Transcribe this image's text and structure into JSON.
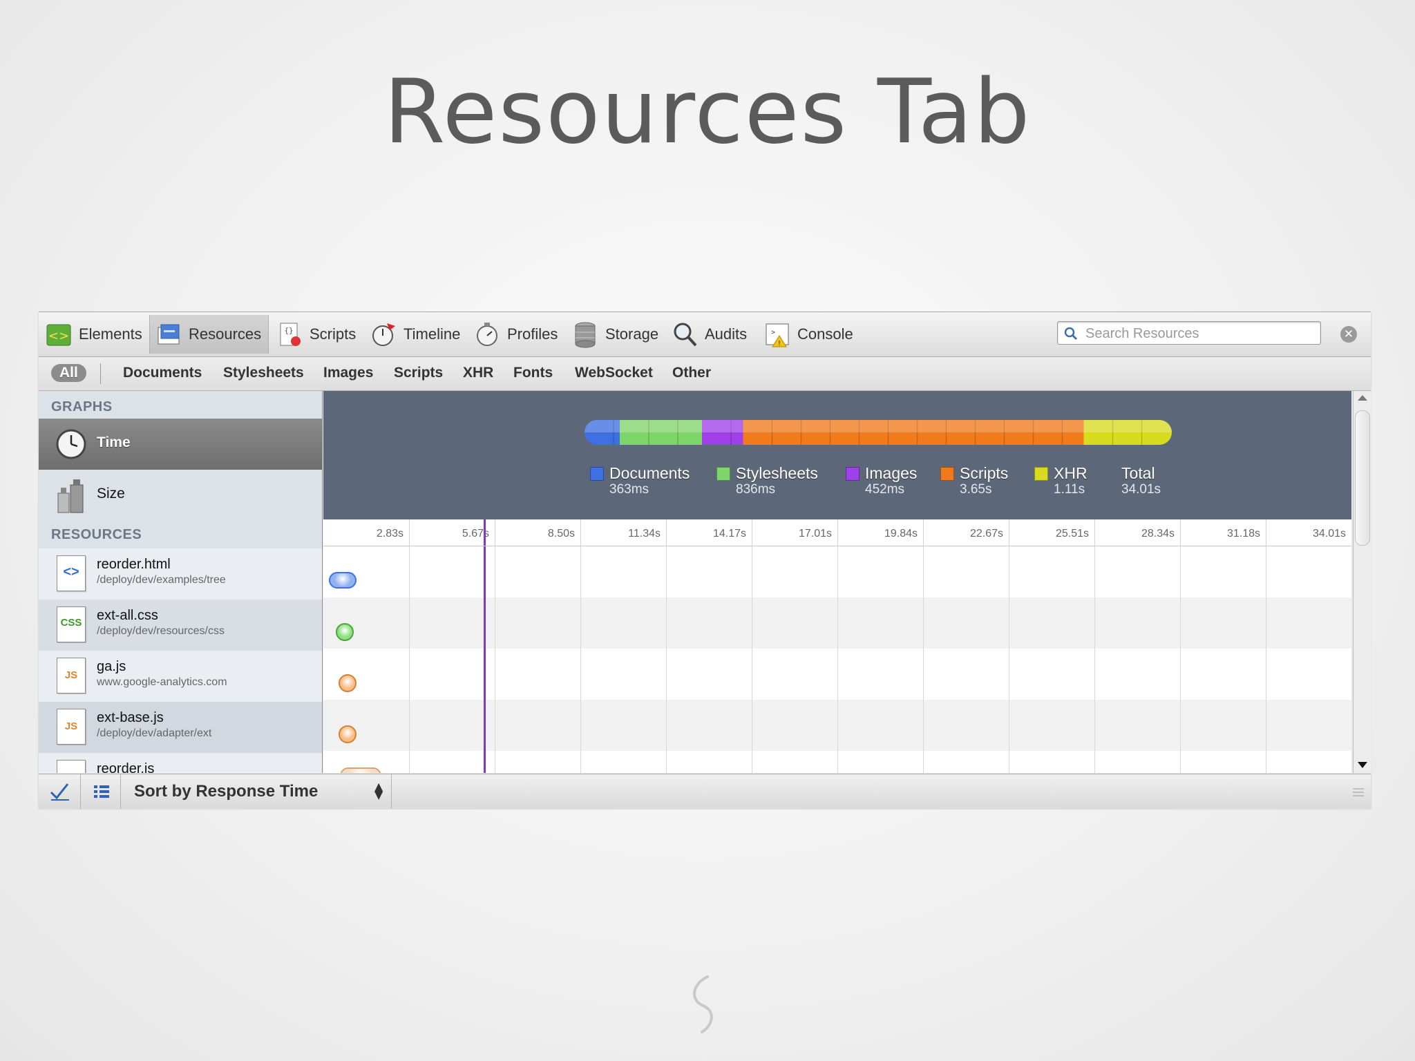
{
  "slide": {
    "title": "Resources Tab"
  },
  "toolbar": {
    "tabs": [
      {
        "label": "Elements",
        "icon": "elements-icon"
      },
      {
        "label": "Resources",
        "icon": "resources-icon",
        "selected": true
      },
      {
        "label": "Scripts",
        "icon": "scripts-icon"
      },
      {
        "label": "Timeline",
        "icon": "timeline-icon"
      },
      {
        "label": "Profiles",
        "icon": "profiles-icon"
      },
      {
        "label": "Storage",
        "icon": "storage-icon"
      },
      {
        "label": "Audits",
        "icon": "audits-icon"
      },
      {
        "label": "Console",
        "icon": "console-icon"
      }
    ],
    "search_placeholder": "Search Resources"
  },
  "filters": [
    "All",
    "Documents",
    "Stylesheets",
    "Images",
    "Scripts",
    "XHR",
    "Fonts",
    "WebSocket",
    "Other"
  ],
  "sidebar": {
    "graphs_header": "GRAPHS",
    "graphs": [
      {
        "label": "Time",
        "selected": true
      },
      {
        "label": "Size"
      }
    ],
    "resources_header": "RESOURCES",
    "resources": [
      {
        "name": "reorder.html",
        "path": "/deploy/dev/examples/tree",
        "type": "html",
        "badge": "<>"
      },
      {
        "name": "ext-all.css",
        "path": "/deploy/dev/resources/css",
        "type": "css",
        "badge": "CSS"
      },
      {
        "name": "ga.js",
        "path": "www.google-analytics.com",
        "type": "js",
        "badge": "JS"
      },
      {
        "name": "ext-base.js",
        "path": "/deploy/dev/adapter/ext",
        "type": "js",
        "badge": "JS"
      },
      {
        "name": "reorder.js",
        "path": "",
        "type": "js",
        "badge": "JS"
      }
    ]
  },
  "summary": {
    "legend": [
      {
        "name": "Documents",
        "value": "363ms",
        "color": "#3f6fe0"
      },
      {
        "name": "Stylesheets",
        "value": "836ms",
        "color": "#7fd46a"
      },
      {
        "name": "Images",
        "value": "452ms",
        "color": "#a040e8"
      },
      {
        "name": "Scripts",
        "value": "3.65s",
        "color": "#f07a1c"
      },
      {
        "name": "XHR",
        "value": "1.11s",
        "color": "#d8dc1e"
      }
    ],
    "total_label": "Total",
    "total_value": "34.01s",
    "bar_fractions": [
      0.06,
      0.14,
      0.07,
      0.58,
      0.15
    ]
  },
  "timeline": {
    "ticks": [
      "2.83s",
      "5.67s",
      "8.50s",
      "11.34s",
      "14.17s",
      "17.01s",
      "19.84s",
      "22.67s",
      "25.51s",
      "28.34s",
      "31.18s",
      "34.01s"
    ],
    "max": 34.01,
    "marker_time": 5.3
  },
  "bottombar": {
    "sort_label": "Sort by Response Time"
  }
}
